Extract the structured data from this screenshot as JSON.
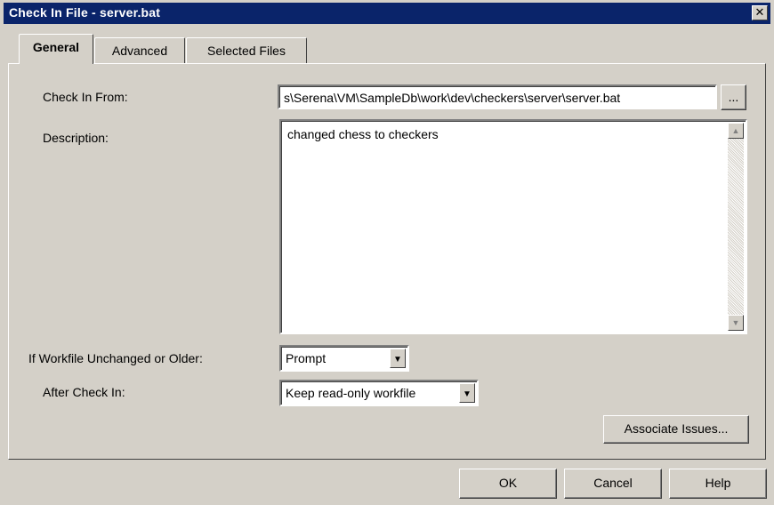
{
  "window": {
    "title": "Check In File - server.bat",
    "close_glyph": "✕"
  },
  "tabs": [
    {
      "label": "General",
      "active": true
    },
    {
      "label": "Advanced",
      "active": false
    },
    {
      "label": "Selected Files",
      "active": false
    }
  ],
  "form": {
    "check_in_from_label": "Check In From:",
    "check_in_from_value": "s\\Serena\\VM\\SampleDb\\work\\dev\\checkers\\server\\server.bat",
    "browse_label": "...",
    "description_label": "Description:",
    "description_value": "changed chess to checkers",
    "unchanged_label": "If Workfile Unchanged or Older:",
    "unchanged_value": "Prompt",
    "after_label": "After Check In:",
    "after_value": "Keep read-only workfile",
    "associate_label": "Associate Issues..."
  },
  "footer": {
    "ok_label": "OK",
    "cancel_label": "Cancel",
    "help_label": "Help"
  },
  "icons": {
    "scroll_up": "▲",
    "scroll_down": "▼",
    "dropdown_arrow": "▼"
  }
}
